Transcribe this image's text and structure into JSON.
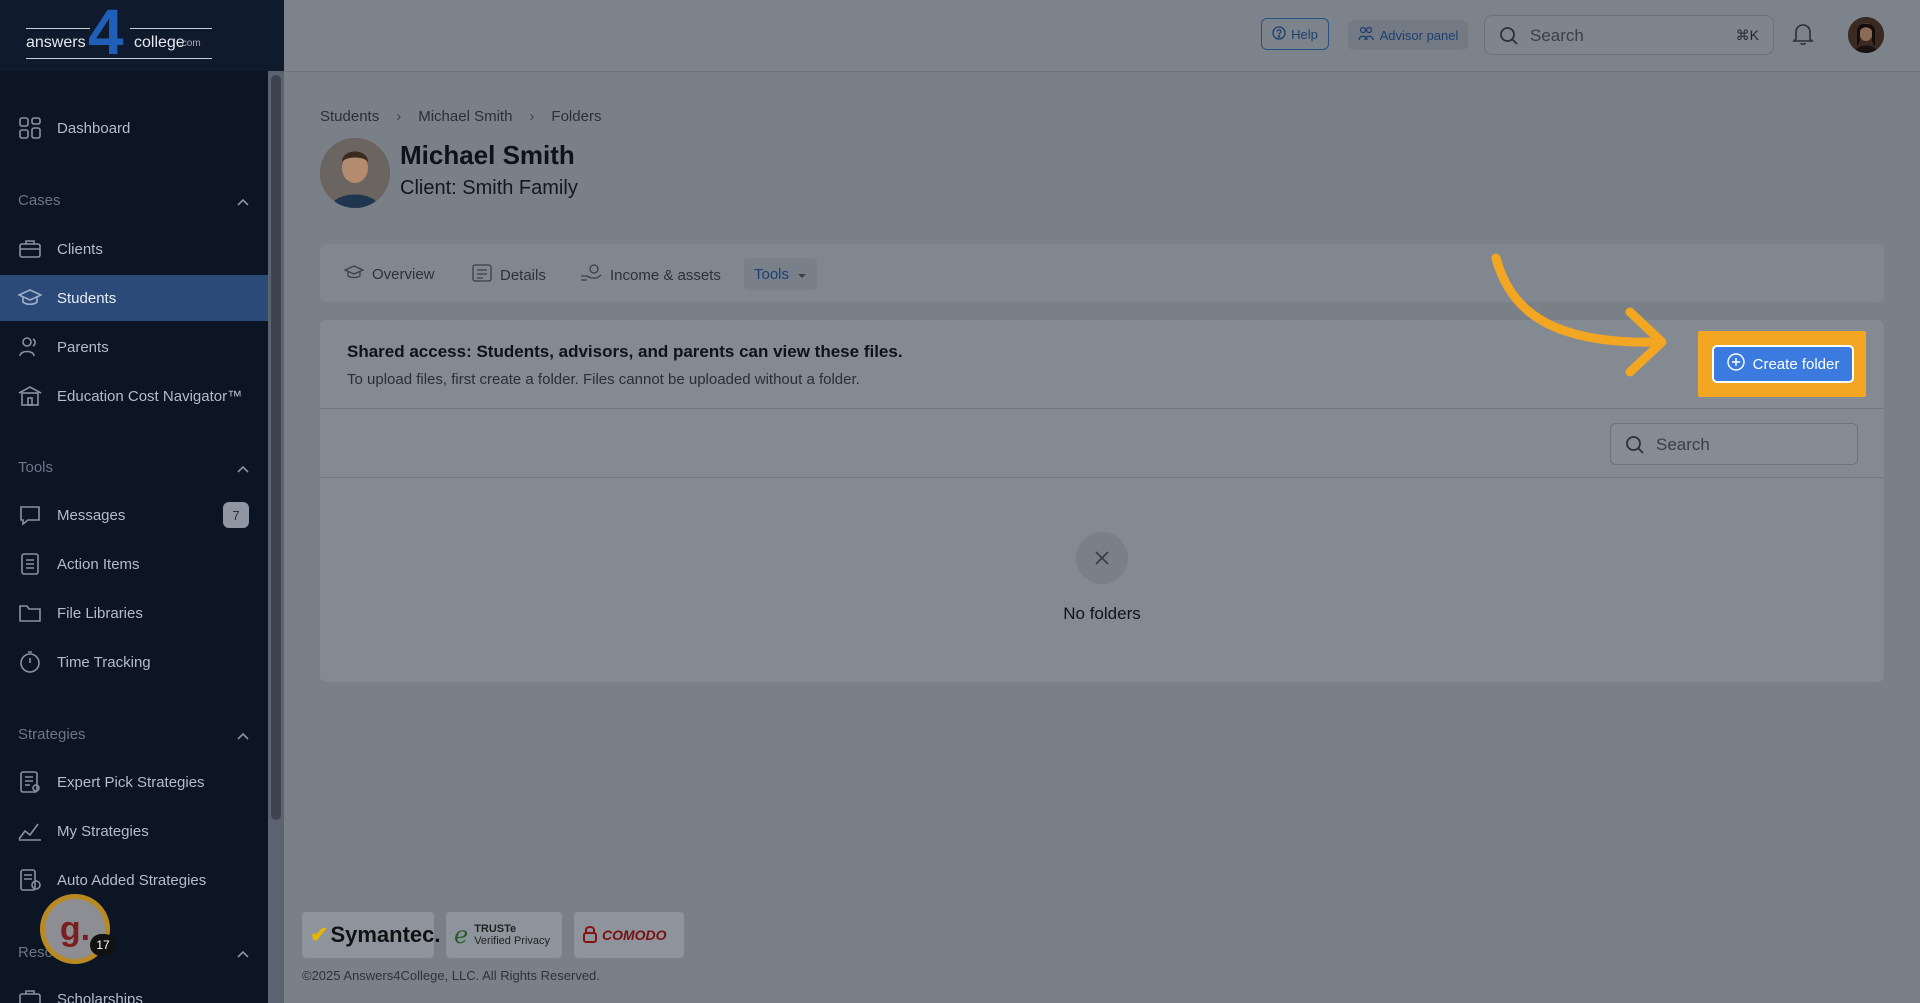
{
  "brand": {
    "word1": "answers",
    "digit": "4",
    "word2": "college",
    "suffix": ".com"
  },
  "sidebar": {
    "dashboard": "Dashboard",
    "sections": {
      "cases": "Cases",
      "tools": "Tools",
      "strategies": "Strategies",
      "resources": "Reso"
    },
    "cases_items": [
      "Clients",
      "Students",
      "Parents",
      "Education Cost Navigator™"
    ],
    "tools_items": [
      "Messages",
      "Action Items",
      "File Libraries",
      "Time Tracking"
    ],
    "messages_badge": "7",
    "strategies_items": [
      "Expert Pick Strategies",
      "My Strategies",
      "Auto Added Strategies"
    ],
    "resources_items": [
      "Scholarships"
    ]
  },
  "topbar": {
    "help": "Help",
    "advisor_panel": "Advisor panel",
    "search_placeholder": "Search",
    "shortcut": "⌘K"
  },
  "breadcrumb": [
    "Students",
    "Michael Smith",
    "Folders"
  ],
  "student": {
    "name": "Michael Smith",
    "client": "Client: Smith Family"
  },
  "tabs": [
    "Overview",
    "Details",
    "Income & assets",
    "Tools"
  ],
  "panel": {
    "title": "Shared access: Students, advisors, and parents can view these files.",
    "description": "To upload files, first create a folder. Files cannot be uploaded without a folder.",
    "create_button": "Create folder",
    "search_placeholder": "Search",
    "empty_text": "No folders"
  },
  "footer": {
    "seal1": "Symantec.",
    "seal2_line1": "TRUSTe",
    "seal2_line2": "Verified Privacy",
    "seal3": "COMODO",
    "copyright": "©2025 Answers4College, LLC. All Rights Reserved."
  },
  "widget": {
    "letter": "g.",
    "badge": "17"
  },
  "colors": {
    "accent": "#3b7be0",
    "highlight": "#f3a621",
    "sidebar_bg": "#0c1524"
  }
}
